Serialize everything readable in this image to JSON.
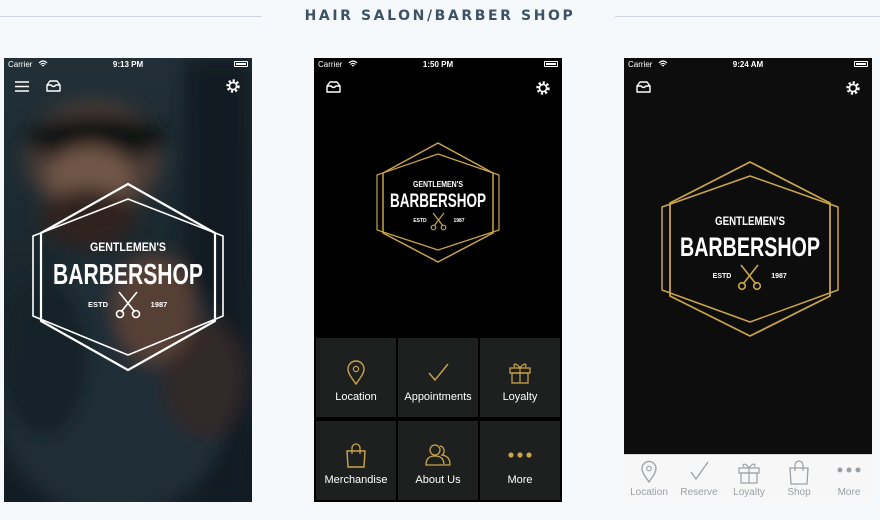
{
  "page": {
    "title": "HAIR SALON/BARBER SHOP"
  },
  "logo": {
    "line1": "GENTLEMEN'S",
    "line2": "BARBERSHOP",
    "left": "ESTD",
    "right": "1987"
  },
  "phones": [
    {
      "status": {
        "carrier": "Carrier",
        "time": "9:13 PM"
      },
      "icons": [
        "menu-icon",
        "mail-icon",
        "gear-icon",
        "scissors-icon"
      ]
    },
    {
      "status": {
        "carrier": "Carrier",
        "time": "1:50 PM"
      },
      "icons": [
        "mail-icon",
        "gear-icon"
      ],
      "grid": [
        {
          "label": "Location",
          "icon": "location-pin-icon"
        },
        {
          "label": "Appointments",
          "icon": "checkmark-icon"
        },
        {
          "label": "Loyalty",
          "icon": "gift-icon"
        },
        {
          "label": "Merchandise",
          "icon": "shopping-bag-icon"
        },
        {
          "label": "About Us",
          "icon": "people-icon"
        },
        {
          "label": "More",
          "icon": "more-dots-icon"
        }
      ]
    },
    {
      "status": {
        "carrier": "Carrier",
        "time": "9:24 AM"
      },
      "icons": [
        "mail-icon",
        "gear-icon"
      ],
      "tabs": [
        {
          "label": "Location",
          "icon": "location-pin-icon"
        },
        {
          "label": "Reserve",
          "icon": "checkmark-icon"
        },
        {
          "label": "Loyalty",
          "icon": "gift-icon"
        },
        {
          "label": "Shop",
          "icon": "shopping-bag-icon"
        },
        {
          "label": "More",
          "icon": "more-dots-icon"
        }
      ]
    }
  ],
  "colors": {
    "gold": "#c9a449",
    "dark": "#0d0d0e",
    "background": "#f5f9fc",
    "title": "#3d5266"
  }
}
